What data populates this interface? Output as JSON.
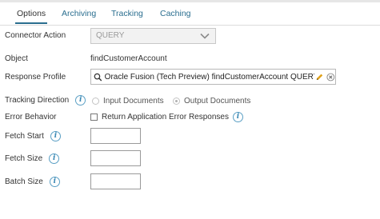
{
  "tabs": [
    {
      "label": "Options"
    },
    {
      "label": "Archiving"
    },
    {
      "label": "Tracking"
    },
    {
      "label": "Caching"
    }
  ],
  "fields": {
    "connector_action": {
      "label": "Connector Action",
      "value": "QUERY"
    },
    "object": {
      "label": "Object",
      "value": "findCustomerAccount"
    },
    "response_profile": {
      "label": "Response Profile",
      "value": "Oracle Fusion (Tech Preview) findCustomerAccount QUERY"
    },
    "tracking_direction": {
      "label": "Tracking Direction",
      "options": [
        "Input Documents",
        "Output Documents"
      ],
      "selected": "Output Documents"
    },
    "error_behavior": {
      "label": "Error Behavior",
      "checkbox_label": "Return Application Error Responses",
      "checked": false
    },
    "fetch_start": {
      "label": "Fetch Start",
      "value": ""
    },
    "fetch_size": {
      "label": "Fetch Size",
      "value": ""
    },
    "batch_size": {
      "label": "Batch Size",
      "value": ""
    }
  },
  "icons": {
    "info": "info-icon",
    "search": "search-icon",
    "edit": "pencil-icon",
    "clear": "clear-icon",
    "dropdown": "chevron-down-icon"
  },
  "colors": {
    "link": "#2a6e8f",
    "info": "#3a88b4",
    "pencil": "#e0a21b"
  }
}
